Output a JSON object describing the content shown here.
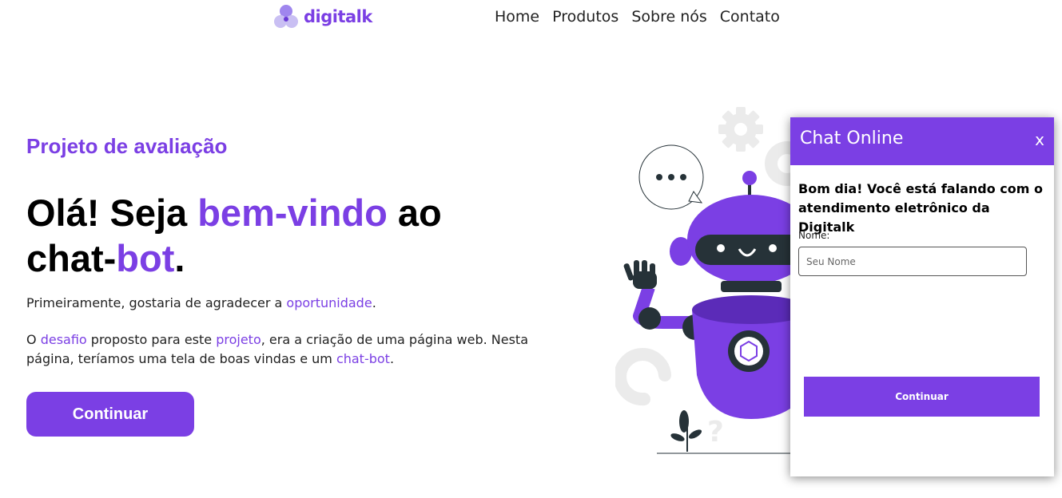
{
  "header": {
    "logo_text": "digitalk",
    "nav": [
      "Home",
      "Produtos",
      "Sobre nós",
      "Contato"
    ]
  },
  "hero": {
    "kicker": "Projeto de avaliação",
    "title_part1": "Olá! Seja ",
    "title_highlight1": "bem-vindo",
    "title_part2": " ao chat-",
    "title_highlight2": "bot",
    "title_part3": ".",
    "p1_a": "Primeiramente, gostaria de agradecer a ",
    "p1_link": "oportunidade",
    "p1_b": ".",
    "p2_a": "O ",
    "p2_link1": "desafio",
    "p2_b": " proposto para este ",
    "p2_link2": "projeto",
    "p2_c": ", era a criação de uma página web. Nesta página, teríamos uma tela de boas vindas e um ",
    "p2_link3": "chat-bot",
    "p2_d": ".",
    "button_label": "Continuar"
  },
  "chat": {
    "title": "Chat Online",
    "close_label": "x",
    "greeting": "Bom dia! Você está falando com o atendimento eletrônico da Digitalk",
    "name_label": "Nome:",
    "name_placeholder": "Seu Nome",
    "name_value": "",
    "button_label": "Continuar"
  },
  "colors": {
    "accent": "#7b3fe4",
    "robot_dark": "#263238",
    "decor_gray": "#ebebeb"
  },
  "icons": [
    "logo-mark-icon",
    "robot-illustration",
    "speech-bubble-icon",
    "gear-icon",
    "question-mark-icon",
    "plant-icon"
  ]
}
